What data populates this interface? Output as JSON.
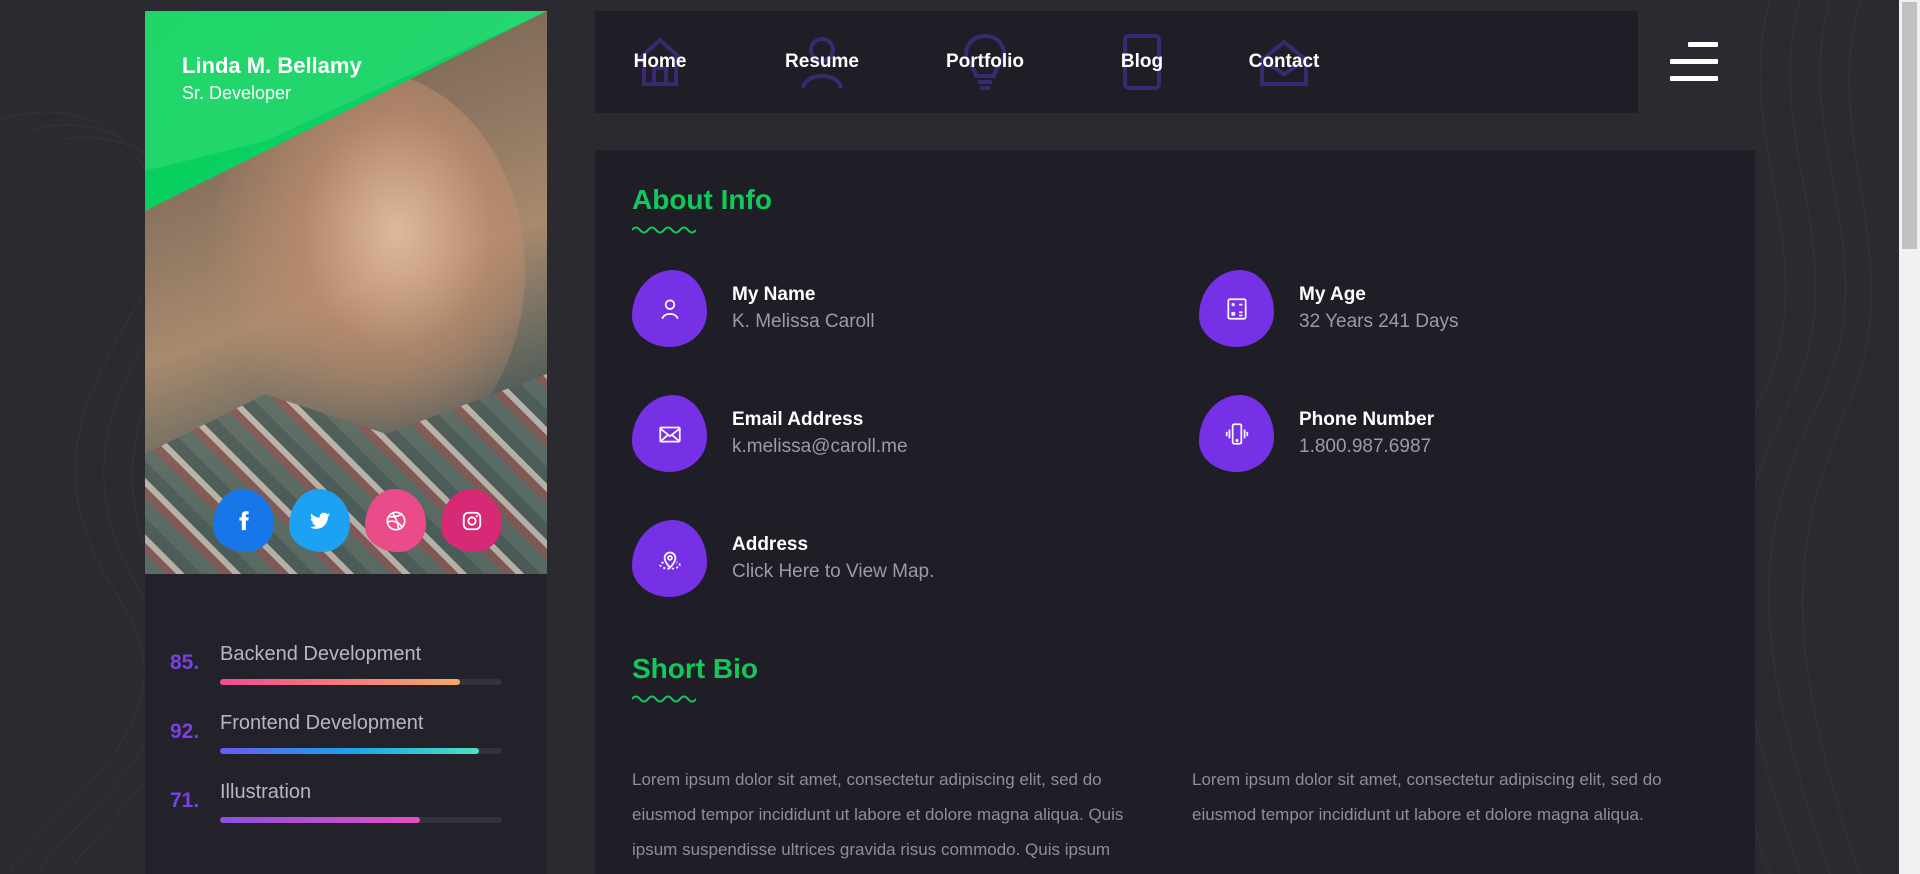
{
  "profile": {
    "name": "Linda M. Bellamy",
    "role": "Sr. Developer",
    "socials": [
      {
        "icon": "facebook-icon",
        "color": "#1877e8"
      },
      {
        "icon": "twitter-icon",
        "color": "#1da1f2"
      },
      {
        "icon": "dribbble-icon",
        "color": "#ea4c89"
      },
      {
        "icon": "instagram-icon",
        "color": "#d62976"
      }
    ]
  },
  "skills": [
    {
      "percent_label": "85.",
      "label": "Backend Development",
      "value": 85,
      "gradient": [
        "#ef4d8f",
        "#f6a86a"
      ]
    },
    {
      "percent_label": "92.",
      "label": "Frontend Development",
      "value": 92,
      "gradient": [
        "#6a5af2",
        "#1aa3ea",
        "#4ee0c0"
      ]
    },
    {
      "percent_label": "71.",
      "label": "Illustration",
      "value": 71,
      "gradient": [
        "#8d4fe0",
        "#e44fc3"
      ]
    }
  ],
  "nav": {
    "items": [
      {
        "label": "Home",
        "icon": "home-icon"
      },
      {
        "label": "Resume",
        "icon": "user-icon"
      },
      {
        "label": "Portfolio",
        "icon": "lightbulb-icon"
      },
      {
        "label": "Blog",
        "icon": "tablet-icon"
      },
      {
        "label": "Contact",
        "icon": "contact-icon"
      }
    ],
    "menu_icon": "hamburger-menu-icon"
  },
  "about": {
    "title": "About Info",
    "items": [
      {
        "label": "My Name",
        "value": "K. Melissa Caroll",
        "icon": "user-icon"
      },
      {
        "label": "My Age",
        "value": "32 Years 241 Days",
        "icon": "calculator-icon"
      },
      {
        "label": "Email Address",
        "value": "k.melissa@caroll.me",
        "icon": "envelope-icon"
      },
      {
        "label": "Phone Number",
        "value": "1.800.987.6987",
        "icon": "phone-vibrate-icon"
      },
      {
        "label": "Address",
        "value": "Click Here to View Map.",
        "icon": "map-pin-icon"
      }
    ]
  },
  "bio": {
    "title": "Short Bio",
    "col1": "Lorem ipsum dolor sit amet, consectetur adipiscing elit, sed do eiusmod tempor incididunt ut labore et dolore magna aliqua. Quis ipsum suspendisse ultrices gravida risus commodo. Quis ipsum",
    "col2": "Lorem ipsum dolor sit amet, consectetur adipiscing elit, sed do eiusmod tempor incididunt ut labore et dolore magna aliqua."
  },
  "colors": {
    "accent_green": "#12c85b",
    "accent_purple": "#7630e6",
    "panel": "#1f1e26",
    "background": "#2b2a31"
  }
}
